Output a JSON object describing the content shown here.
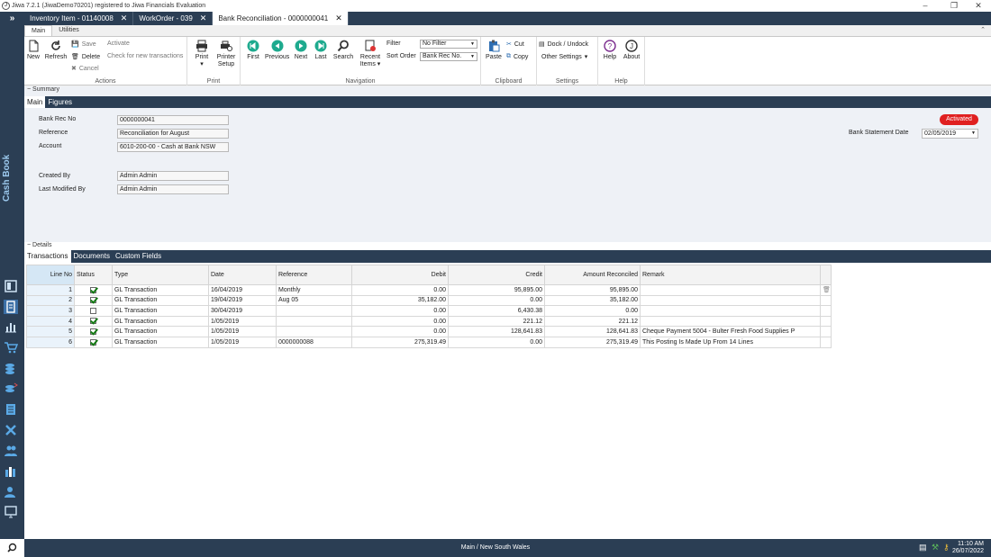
{
  "app": {
    "title": "Jiwa 7.2.1 (JiwaDemo70201) registered to Jiwa Financials Evaluation"
  },
  "doc_tabs": [
    {
      "label": "Inventory Item - 01140008"
    },
    {
      "label": "WorkOrder - 039"
    },
    {
      "label": "Bank Reconciliation - 0000000041"
    }
  ],
  "ribbon_tabs": [
    "Main",
    "Utilities"
  ],
  "ribbon": {
    "new": "New",
    "refresh": "Refresh",
    "save": "Save",
    "delete": "Delete",
    "cancel": "Cancel",
    "activate": "Activate",
    "check_new": "Check for new transactions",
    "actions_group": "Actions",
    "print": "Print",
    "printer": "Printer",
    "setup": "Setup",
    "print_group": "Print",
    "first": "First",
    "previous": "Previous",
    "next": "Next",
    "last": "Last",
    "search": "Search",
    "recent": "Recent",
    "items": "Items",
    "filter_label": "Filter",
    "filter_value": "No Filter",
    "sort_label": "Sort Order",
    "sort_value": "Bank Rec No.",
    "navigation_group": "Navigation",
    "paste": "Paste",
    "cut": "Cut",
    "copy": "Copy",
    "clipboard_group": "Clipboard",
    "dock": "Dock / Undock",
    "other_settings": "Other Settings",
    "settings_group": "Settings",
    "help": "Help",
    "about": "About",
    "help_group": "Help"
  },
  "sidebar": {
    "title": "Cash Book"
  },
  "summary": {
    "header": "Summary",
    "tabs": [
      "Main",
      "Figures"
    ],
    "bank_rec_no_label": "Bank Rec No",
    "bank_rec_no": "0000000041",
    "reference_label": "Reference",
    "reference": "Reconciliation for August",
    "account_label": "Account",
    "account": "6010-200-00 - Cash at Bank NSW",
    "created_by_label": "Created By",
    "created_by": "Admin Admin",
    "modified_label": "Last Modified By",
    "modified_by": "Admin Admin",
    "status_badge": "Activated",
    "statement_date_label": "Bank Statement Date",
    "statement_date": "02/05/2019"
  },
  "details": {
    "header": "Details",
    "tabs": [
      "Transactions",
      "Documents",
      "Custom Fields"
    ],
    "columns": [
      "Line No",
      "Status",
      "Type",
      "Date",
      "Reference",
      "Debit",
      "Credit",
      "Amount Reconciled",
      "Remark"
    ],
    "rows": [
      {
        "line": "1",
        "status": true,
        "type": "GL Transaction",
        "date": "16/04/2019",
        "reference": "Monthly",
        "debit": "0.00",
        "credit": "95,895.00",
        "amount": "95,895.00",
        "remark": ""
      },
      {
        "line": "2",
        "status": true,
        "type": "GL Transaction",
        "date": "19/04/2019",
        "reference": "Aug 05",
        "debit": "35,182.00",
        "credit": "0.00",
        "amount": "35,182.00",
        "remark": ""
      },
      {
        "line": "3",
        "status": false,
        "type": "GL Transaction",
        "date": "30/04/2019",
        "reference": "",
        "debit": "0.00",
        "credit": "6,430.38",
        "amount": "0.00",
        "remark": ""
      },
      {
        "line": "4",
        "status": true,
        "type": "GL Transaction",
        "date": "1/05/2019",
        "reference": "",
        "debit": "0.00",
        "credit": "221.12",
        "amount": "221.12",
        "remark": ""
      },
      {
        "line": "5",
        "status": true,
        "type": "GL Transaction",
        "date": "1/05/2019",
        "reference": "",
        "debit": "0.00",
        "credit": "128,641.83",
        "amount": "128,641.83",
        "remark": "Cheque Payment 5004 - Bulter Fresh Food Supplies P"
      },
      {
        "line": "6",
        "status": true,
        "type": "GL Transaction",
        "date": "1/05/2019",
        "reference": "0000000088",
        "debit": "275,319.49",
        "credit": "0.00",
        "amount": "275,319.49",
        "remark": "This Posting Is Made Up From  14 Lines"
      }
    ]
  },
  "statusbar": {
    "location": "Main / New South Wales",
    "time": "11:10 AM",
    "date": "26/07/2022"
  },
  "colors": {
    "navy": "#2b3e54",
    "accent_red": "#e02020",
    "nav_green": "#1eaa8e"
  }
}
